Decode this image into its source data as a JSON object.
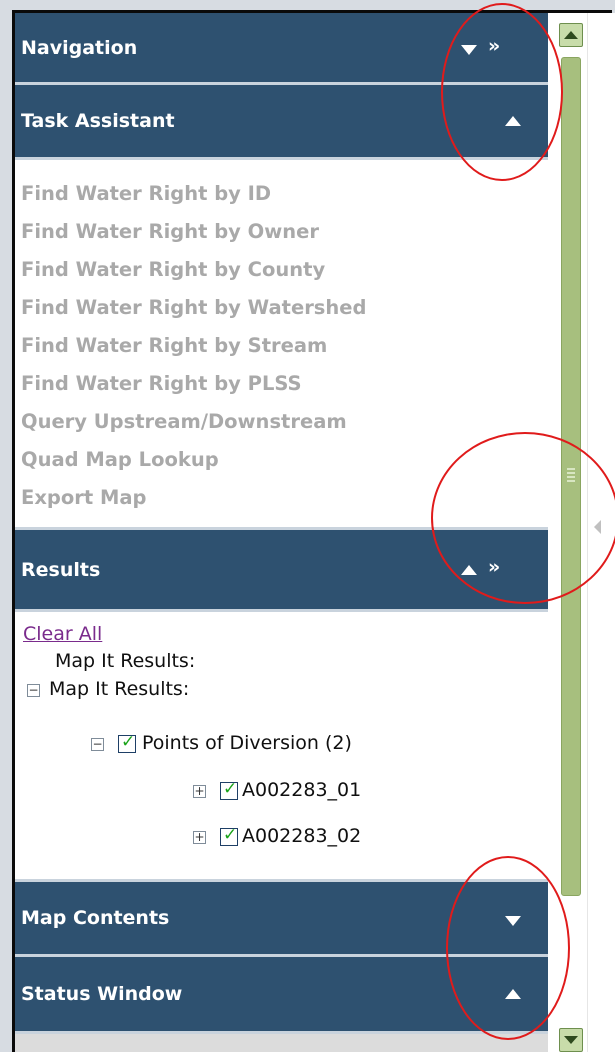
{
  "panels": {
    "navigation": {
      "title": "Navigation",
      "dock_label": "»"
    },
    "task_assistant": {
      "title": "Task Assistant",
      "tasks": [
        "Find Water Right by ID",
        "Find Water Right by Owner",
        "Find Water Right by County",
        "Find Water Right by Watershed",
        "Find Water Right by Stream",
        "Find Water Right by PLSS",
        "Query Upstream/Downstream",
        "Quad Map Lookup",
        "Export Map"
      ]
    },
    "results": {
      "title": "Results",
      "dock_label": "»",
      "clear_all": "Clear All",
      "map_it_label": "Map It Results:",
      "tree": {
        "root": "Map It Results:",
        "group": "Points of Diversion (2)",
        "items": [
          "A002283_01",
          "A002283_02"
        ],
        "expand_symbol": "+",
        "collapse_symbol": "−",
        "check_symbol": "✓"
      }
    },
    "map_contents": {
      "title": "Map Contents"
    },
    "status_window": {
      "title": "Status Window"
    }
  },
  "colors": {
    "header_bg": "#2e5170",
    "task_text": "#a9a9a9",
    "annotation_ring": "#e01b1b",
    "scroll_thumb": "#a7bf7e"
  }
}
